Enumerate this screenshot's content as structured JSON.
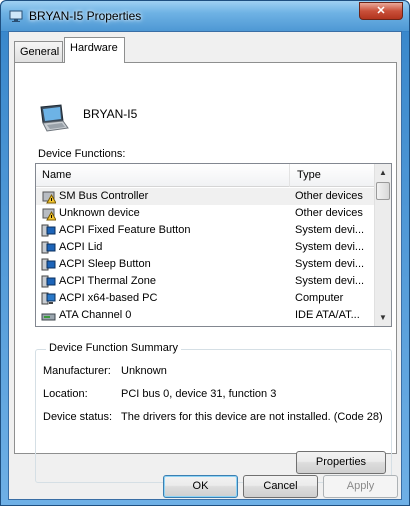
{
  "window": {
    "title": "BRYAN-I5 Properties",
    "close_glyph": "✕"
  },
  "tabs": [
    {
      "label": "General"
    },
    {
      "label": "Hardware"
    }
  ],
  "device": {
    "name": "BRYAN-I5",
    "icon": "laptop-icon"
  },
  "device_functions": {
    "label": "Device Functions:",
    "columns": {
      "name": "Name",
      "type": "Type"
    },
    "rows": [
      {
        "name": "SM Bus Controller",
        "type": "Other devices",
        "icon": "warning-device-icon",
        "selected": true
      },
      {
        "name": "Unknown device",
        "type": "Other devices",
        "icon": "warning-device-icon"
      },
      {
        "name": "ACPI Fixed Feature Button",
        "type": "System devi...",
        "icon": "system-device-icon"
      },
      {
        "name": "ACPI Lid",
        "type": "System devi...",
        "icon": "system-device-icon"
      },
      {
        "name": "ACPI Sleep Button",
        "type": "System devi...",
        "icon": "system-device-icon"
      },
      {
        "name": "ACPI Thermal Zone",
        "type": "System devi...",
        "icon": "system-device-icon"
      },
      {
        "name": "ACPI x64-based PC",
        "type": "Computer",
        "icon": "computer-icon"
      },
      {
        "name": "ATA Channel 0",
        "type": "IDE ATA/AT...",
        "icon": "ide-controller-icon"
      }
    ]
  },
  "summary": {
    "title": "Device Function Summary",
    "manufacturer_label": "Manufacturer:",
    "manufacturer": "Unknown",
    "location_label": "Location:",
    "location": "PCI bus 0, device 31, function 3",
    "status_label": "Device status:",
    "status": "The drivers for this device are not installed. (Code 28)",
    "properties_button": "Properties"
  },
  "buttons": {
    "ok": "OK",
    "cancel": "Cancel",
    "apply": "Apply"
  },
  "colors": {
    "accent": "#2d7cc4",
    "selection": "#f0f0f0",
    "close": "#c9503a"
  }
}
